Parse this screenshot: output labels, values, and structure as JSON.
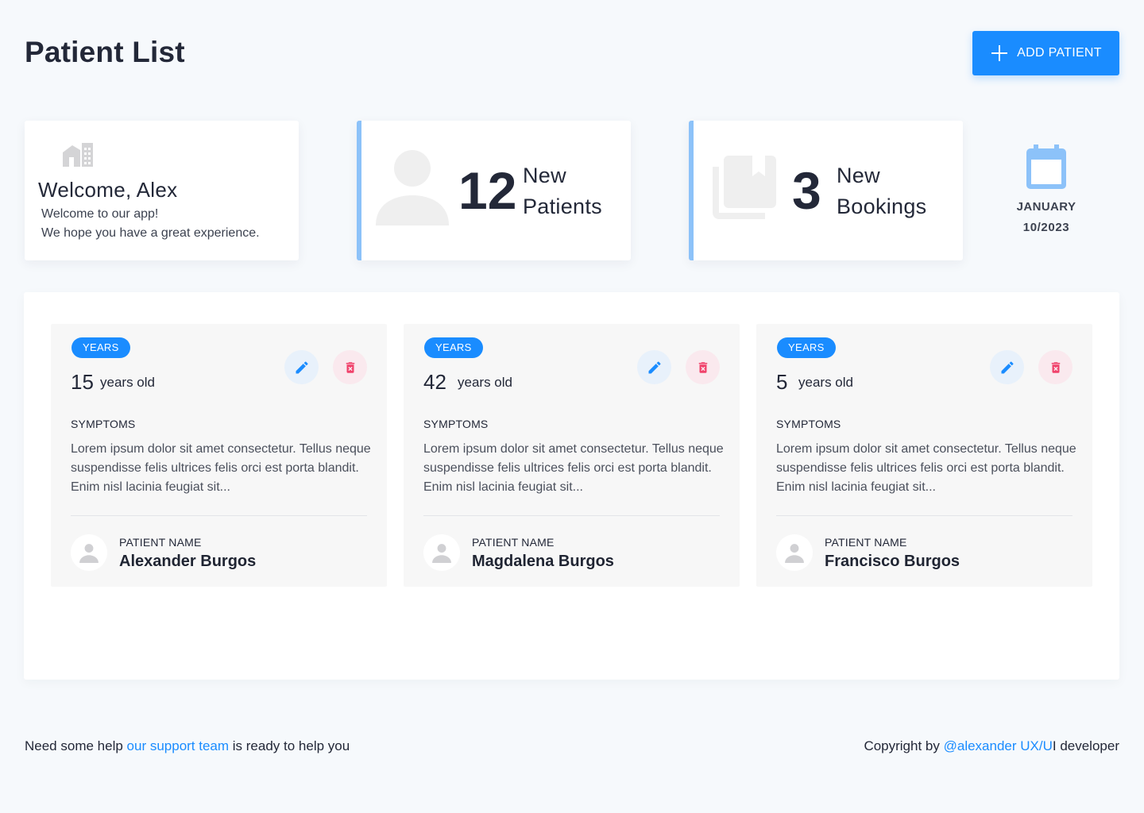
{
  "header": {
    "title": "Patient List",
    "add_button_label": "ADD PATIENT",
    "add_icon": "plus-icon"
  },
  "welcome": {
    "icon": "home-icon",
    "heading": "Welcome, Alex",
    "line1": "Welcome to our app!",
    "line2": "We hope you have a great experience."
  },
  "stats": {
    "patients": {
      "icon": "person-icon",
      "count": "12",
      "label_line1": "New",
      "label_line2": "Patients"
    },
    "bookings": {
      "icon": "library-books-icon",
      "count": "3",
      "label_line1": "New",
      "label_line2": "Bookings"
    }
  },
  "date": {
    "icon": "calendar-icon",
    "month": "JANUARY",
    "value": "10/2023"
  },
  "patients": [
    {
      "badge": "YEARS",
      "age": "15",
      "age_unit": "years old",
      "symptoms_label": "SYMPTOMS",
      "symptoms": "Lorem ipsum dolor sit amet consectetur. Tellus neque suspendisse felis ultrices felis orci est porta blandit. Enim nisl lacinia feugiat sit...",
      "name_label": "PATIENT NAME",
      "name": "Alexander Burgos"
    },
    {
      "badge": "YEARS",
      "age": "42",
      "age_unit": "years old",
      "symptoms_label": "SYMPTOMS",
      "symptoms": "Lorem ipsum dolor sit amet consectetur. Tellus neque suspendisse felis ultrices felis orci est porta blandit. Enim nisl lacinia feugiat sit...",
      "name_label": "PATIENT NAME",
      "name": "Magdalena Burgos"
    },
    {
      "badge": "YEARS",
      "age": "5",
      "age_unit": "years old",
      "symptoms_label": "SYMPTOMS",
      "symptoms": "Lorem ipsum dolor sit amet consectetur. Tellus neque suspendisse felis ultrices felis orci est porta blandit. Enim nisl lacinia feugiat sit...",
      "name_label": "PATIENT NAME",
      "name": "Francisco Burgos"
    }
  ],
  "footer": {
    "help_prefix": "Need some help ",
    "help_link": "our support team",
    "help_suffix": " is ready to help you",
    "copy_prefix": "Copyright by ",
    "copy_link": "@alexander UX/U",
    "copy_suffix": "I developer"
  },
  "colors": {
    "accent": "#1a8cff",
    "accent_light": "#8cc2f9",
    "danger": "#f0426b",
    "background": "#f6f9fc"
  }
}
